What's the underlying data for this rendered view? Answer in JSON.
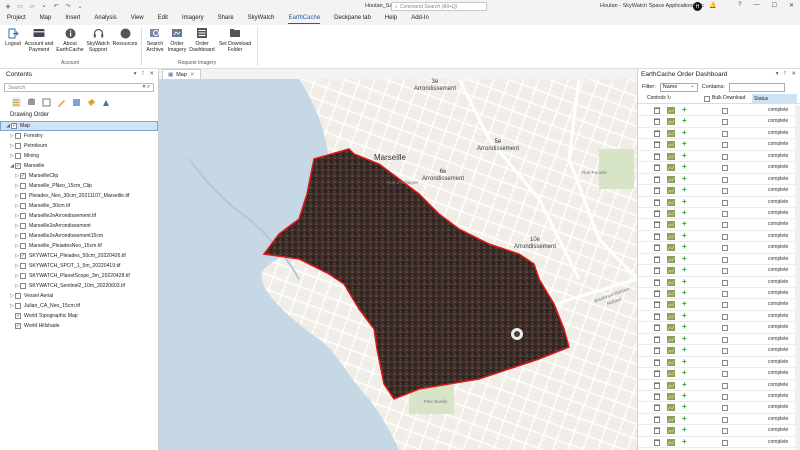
{
  "titlebar": {
    "doc_title": "Houtan_Samples",
    "search_placeholder": "Command Search (Alt+Q)",
    "user": "Houtan - SkyWatch Space Applications Inc",
    "avatar_initial": "H",
    "controls": [
      "?",
      "—",
      "☐",
      "✕"
    ]
  },
  "ribbon_tabs": [
    "Project",
    "Map",
    "Insert",
    "Analysis",
    "View",
    "Edit",
    "Imagery",
    "Share",
    "SkyWatch",
    "EarthCache",
    "Deckpane lab",
    "Help",
    "Add-In"
  ],
  "active_tab": "EarthCache",
  "ribbon": {
    "account_buttons": [
      {
        "label": "Logout",
        "icon": "logout-icon"
      },
      {
        "label": "Account and Payment",
        "icon": "account-card-icon"
      },
      {
        "label": "About EarthCache",
        "icon": "info-icon"
      },
      {
        "label": "SkyWatch Support",
        "icon": "headset-icon"
      },
      {
        "label": "Resources",
        "icon": "resources-icon"
      }
    ],
    "account_group": "Account",
    "imagery_buttons": [
      {
        "label": "Search Archive",
        "icon": "search-archive-icon"
      },
      {
        "label": "Order Imagery",
        "icon": "order-imagery-icon"
      },
      {
        "label": "Order Dashboard",
        "icon": "dashboard-icon"
      },
      {
        "label": "Set Download Folder",
        "icon": "folder-icon"
      }
    ],
    "imagery_group": "Request Imagery"
  },
  "contents": {
    "title": "Contents",
    "search_placeholder": "Search",
    "drawing_order": "Drawing Order",
    "layers": [
      {
        "name": "Map",
        "checked": true,
        "expanded": true,
        "level": 0,
        "selected": true
      },
      {
        "name": "Forestry",
        "checked": false,
        "expanded": false,
        "level": 1
      },
      {
        "name": "Petroleum",
        "checked": false,
        "expanded": false,
        "level": 1
      },
      {
        "name": "Mining",
        "checked": false,
        "expanded": false,
        "level": 1
      },
      {
        "name": "Marseille",
        "checked": true,
        "expanded": true,
        "level": 1
      },
      {
        "name": "MarseilleClip",
        "checked": true,
        "expanded": false,
        "level": 2
      },
      {
        "name": "Marseille_PNeo_15cm_Clip",
        "checked": false,
        "expanded": false,
        "level": 2
      },
      {
        "name": "Pleiades_Neo_30cm_20211107_Marseille.tif",
        "checked": false,
        "expanded": false,
        "level": 2
      },
      {
        "name": "Marseille_30cm.tif",
        "checked": false,
        "expanded": false,
        "level": 2
      },
      {
        "name": "Marseille2eArrondissement.tif",
        "checked": false,
        "expanded": false,
        "level": 2
      },
      {
        "name": "Marseille2eArrondissement",
        "checked": false,
        "expanded": false,
        "level": 2
      },
      {
        "name": "Marseille2eArrondissement15cm",
        "checked": false,
        "expanded": false,
        "level": 2
      },
      {
        "name": "Marseille_PleiadesNeo_15cm.tif",
        "checked": false,
        "expanded": false,
        "level": 2
      },
      {
        "name": "SKYWATCH_Pleiades_50cm_20220426.tif",
        "checked": true,
        "expanded": false,
        "level": 2
      },
      {
        "name": "SKYWATCH_SPOT_1_5m_20220419.tif",
        "checked": false,
        "expanded": false,
        "level": 2
      },
      {
        "name": "SKYWATCH_PlanetScope_3m_20220428.tif",
        "checked": false,
        "expanded": false,
        "level": 2
      },
      {
        "name": "SKYWATCH_Sentinel2_10m_20220603.tif",
        "checked": false,
        "expanded": false,
        "level": 2
      },
      {
        "name": "Vessel Aerial",
        "checked": false,
        "expanded": false,
        "level": 1
      },
      {
        "name": "Julian_CA_Neo_15cm.tif",
        "checked": false,
        "expanded": false,
        "level": 1
      },
      {
        "name": "World Topographic Map",
        "checked": true,
        "expanded": null,
        "level": 1
      },
      {
        "name": "World Hillshade",
        "checked": true,
        "expanded": null,
        "level": 1
      }
    ]
  },
  "map": {
    "tab_label": "Map",
    "labels": {
      "marseille": "Marseille",
      "arr3": "3e\nArrondissement",
      "arr5": "5e\nArrondissement",
      "arr6": "6e\nArrondissement",
      "arr10": "10e\nArrondissement",
      "rue_aubagne": "Rue d'Aubagne",
      "rue_paradis": "Rue Paradis",
      "boulevard": "Boulevard Romain Rolland",
      "parc": "Parc Borély"
    }
  },
  "dashboard": {
    "title": "EarthCache Order Dashboard",
    "filter_label": "Filter:",
    "filter_value": "Name",
    "contains_label": "Contains:",
    "col_controls": "Controls",
    "col_bulk": "Bulk Download",
    "col_status": "Status",
    "rows": [
      "complete",
      "complete",
      "complete",
      "complete",
      "complete",
      "complete",
      "complete",
      "complete",
      "complete",
      "complete",
      "complete",
      "complete",
      "complete",
      "complete",
      "complete",
      "complete",
      "complete",
      "complete",
      "complete",
      "complete",
      "complete",
      "complete",
      "complete",
      "complete",
      "complete",
      "complete",
      "complete",
      "complete",
      "complete",
      "complete"
    ]
  }
}
